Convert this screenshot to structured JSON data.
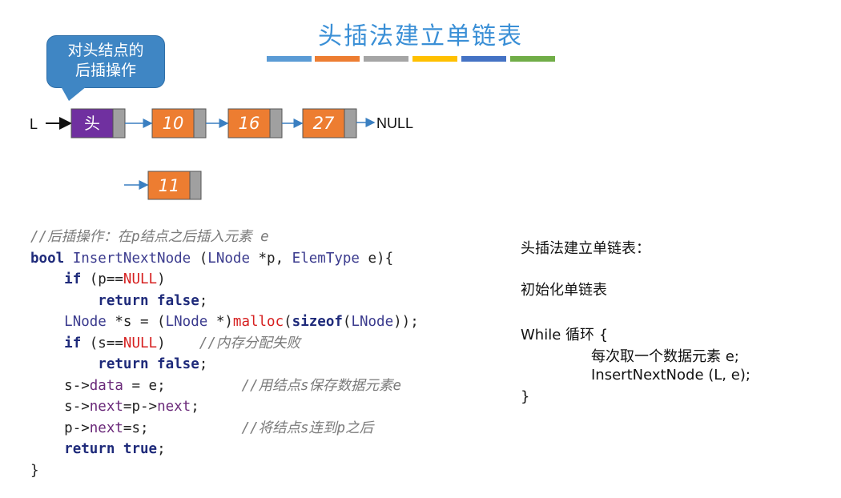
{
  "title": "头插法建立单链表",
  "accent_bars": [
    "#5a9bd5",
    "#ed7d31",
    "#a5a5a5",
    "#ffc000",
    "#4472c4",
    "#70ad47"
  ],
  "callout": {
    "line1": "对头结点的",
    "line2": "后插操作"
  },
  "list": {
    "head_pointer": "L",
    "head_label": "头",
    "nodes": [
      "10",
      "16",
      "27"
    ],
    "tail": "NULL",
    "new_node": "11"
  },
  "code": {
    "comment_header": "//后插操作：在p结点之后插入元素 e",
    "lines": [
      "bool InsertNextNode (LNode *p, ElemType e){",
      "if (p==NULL)",
      "return false;",
      "LNode *s = (LNode *)malloc(sizeof(LNode));",
      "if (s==NULL)",
      "//内存分配失败",
      "return false;",
      "s->data = e;",
      "//用结点s保存数据元素e",
      "s->next=p->next;",
      "p->next=s;",
      "//将结点s连到p之后",
      "return true;",
      "}"
    ]
  },
  "side": {
    "heading": "头插法建立单链表：",
    "init": "初始化单链表",
    "loop_open": "While 循环 {",
    "body1": "每次取一个数据元素 e;",
    "body2": "InsertNextNode (L, e);",
    "loop_close": "}"
  }
}
